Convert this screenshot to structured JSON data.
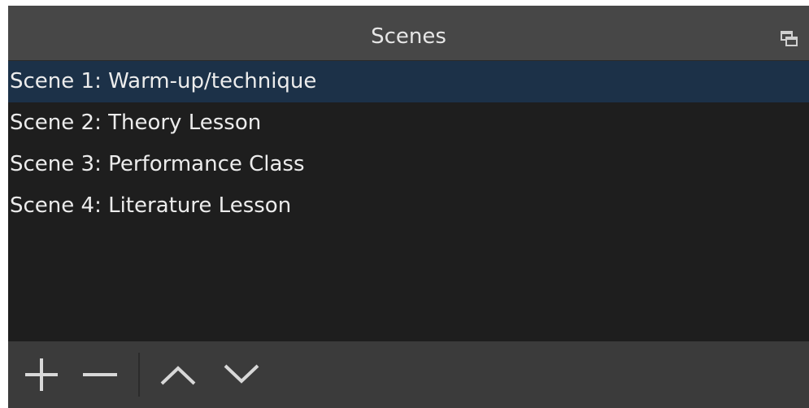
{
  "dock": {
    "title": "Scenes"
  },
  "scenes": [
    {
      "label": "Scene 1: Warm-up/technique",
      "selected": true
    },
    {
      "label": "Scene 2: Theory Lesson",
      "selected": false
    },
    {
      "label": "Scene 3: Performance Class",
      "selected": false
    },
    {
      "label": "Scene 4: Literature Lesson",
      "selected": false
    }
  ],
  "toolbar": {
    "buttons": [
      {
        "name": "add-scene-button",
        "icon": "plus-icon"
      },
      {
        "name": "remove-scene-button",
        "icon": "minus-icon"
      },
      {
        "name": "move-scene-up-button",
        "icon": "chevron-up-icon"
      },
      {
        "name": "move-scene-down-button",
        "icon": "chevron-down-icon"
      }
    ]
  },
  "colors": {
    "title_bar": "#474747",
    "list_background": "#1e1e1e",
    "selected_row": "#1c3148",
    "toolbar": "#3b3b3b",
    "text": "#ececec",
    "icon": "#d8d8d8"
  }
}
